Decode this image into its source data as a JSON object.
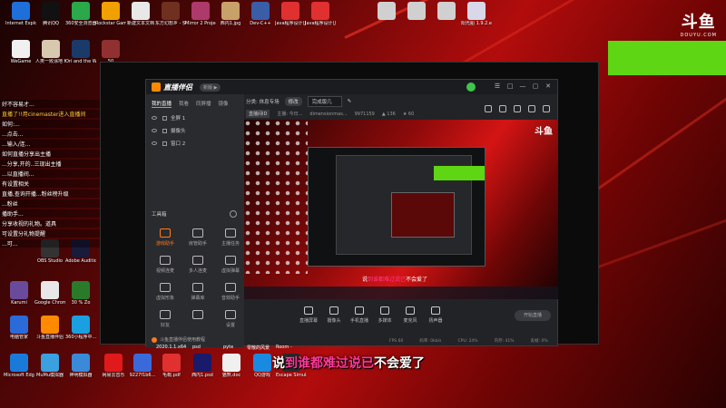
{
  "desktop": {
    "top_row": [
      {
        "label": "Internet Explorer",
        "color": "#1e6fd9"
      },
      {
        "label": "腾讯QQ",
        "color": "#111111"
      },
      {
        "label": "360安全浏览器",
        "color": "#2aa84a"
      },
      {
        "label": "Rockstar Games...",
        "color": "#f0a000"
      },
      {
        "label": "新建文本文档",
        "color": "#e8e8e8"
      },
      {
        "label": "东方幻想乡 - 快捷方式",
        "color": "#703020"
      },
      {
        "label": "Mirror 2 Project X",
        "color": "#ad3a6a"
      },
      {
        "label": "西内1.jpg",
        "color": "#c8a06a"
      },
      {
        "label": "Dev-C++",
        "color": "#3a5da8"
      },
      {
        "label": "Java程序设计(JDK8)...",
        "color": "#e03030"
      },
      {
        "label": "Java程序设计(JDK8)...",
        "color": "#e03030"
      },
      {
        "label": "",
        "color": "#d0d0d0"
      },
      {
        "label": "",
        "color": "#d0d0d0"
      },
      {
        "label": "",
        "color": "#d0d0d0"
      },
      {
        "label": "阳光船 1.9.2.exe...",
        "color": "#d8d8e8"
      }
    ],
    "row2": [
      {
        "label": "WeGame",
        "color": "#f0f0f0"
      },
      {
        "label": "人类一败涂地 Human Fa...",
        "color": "#d8c8b0"
      },
      {
        "label": "Ori and the Will of th...",
        "color": "#1a3a6a"
      },
      {
        "label": "50",
        "color": "#903030"
      }
    ],
    "left_col": [
      {
        "label": "Karumi",
        "color": "#6a4a9a"
      },
      {
        "label": "Google Chrome",
        "color": "#e8e8e8"
      },
      {
        "label": "30 % Zo",
        "color": "#2a7a2a"
      },
      {
        "label": "电脑管家",
        "color": "#2a6ad9"
      },
      {
        "label": "斗鱼直播伴侣",
        "color": "#ff8a00"
      },
      {
        "label": "360小程序中...",
        "color": "#1aa0e0"
      },
      {
        "label": "OBS Studio",
        "color": "#333333"
      },
      {
        "label": "Adobe Audition",
        "color": "#1a1a3a"
      },
      {
        "label": "Microsoft Edge",
        "color": "#1a7ad9"
      },
      {
        "label": "MuMu模拟器",
        "color": "#3aa0e0"
      },
      {
        "label": "神明模拟器",
        "color": "#3a8ad9"
      }
    ],
    "bottom_row": [
      {
        "label": "网易云音乐",
        "color": "#e01a1a"
      },
      {
        "label": "9227f1b6...",
        "color": "#3a6ad9"
      },
      {
        "label": "毛概.pdf",
        "color": "#e03030"
      },
      {
        "label": "西内1.psd",
        "color": "#1a1a6a"
      },
      {
        "label": "猫煞.doc",
        "color": "#f0f0f0"
      },
      {
        "label": "QQ游戏",
        "color": "#1a8ae0"
      },
      {
        "label": "Escape Simulator",
        "color": "#2a2a2a"
      }
    ],
    "bottom_file_labels": [
      "2020.1.1.x64",
      "psd",
      "pyte",
      "零散的风景",
      "Room -"
    ],
    "side_texts": [
      {
        "text": "好不容易才...",
        "highlight": false
      },
      {
        "text": "直播了!!用cinemaster进入直播间",
        "highlight": true
      },
      {
        "text": "如何:...",
        "highlight": false
      },
      {
        "text": "...点击...",
        "highlight": false
      },
      {
        "text": "...输入/连...",
        "highlight": false
      },
      {
        "text": "如何直播分享出主播",
        "highlight": false
      },
      {
        "text": "...分享,开的..三现出主播",
        "highlight": false
      },
      {
        "text": "...以直播间...",
        "highlight": false
      },
      {
        "text": "有设置相关",
        "highlight": false
      },
      {
        "text": "直播,查询开播...粉丝榜升级",
        "highlight": false
      },
      {
        "text": "...粉丝",
        "highlight": false
      },
      {
        "text": "播助手...",
        "highlight": false
      },
      {
        "text": "分享收视的礼物。道具",
        "highlight": false
      },
      {
        "text": "可设置分礼物提醒",
        "highlight": false
      },
      {
        "text": "...可...",
        "highlight": false
      }
    ],
    "logo_big": "斗鱼",
    "logo_small": "DOUYU.COM"
  },
  "app": {
    "name": "直播伴侣",
    "version_pill": "新版 ▶",
    "window_controls": [
      "☰",
      "□",
      "—",
      "▢",
      "✕"
    ],
    "left_tabs": [
      "我的直播",
      "我看",
      "同屏播",
      "镜像"
    ],
    "scene_items": [
      "全屏 1",
      "摄像头",
      "窗口 2"
    ],
    "tools_title": "工具箱",
    "tools": [
      {
        "label": "游戏助手",
        "accent": true
      },
      {
        "label": "房管助手",
        "accent": false
      },
      {
        "label": "主播任务",
        "accent": false
      },
      {
        "label": "视频连麦",
        "accent": false
      },
      {
        "label": "多人连麦",
        "accent": false
      },
      {
        "label": "虚拟弹幕",
        "accent": false
      },
      {
        "label": "虚拟形象",
        "accent": false
      },
      {
        "label": "弹幕库",
        "accent": false
      },
      {
        "label": "音效助手",
        "accent": false
      },
      {
        "label": "好友",
        "accent": false
      },
      {
        "label": "",
        "accent": false
      },
      {
        "label": "设置",
        "accent": false
      }
    ],
    "footer_note": "斗鱼直播伴侣使用教程",
    "info_bar": {
      "category_label": "分类: 休息专场",
      "edit_pill": "修改",
      "title_field": "完成版几",
      "edit_icon": "✎"
    },
    "stats": {
      "tag": "直播间ID",
      "items": [
        "主播: 今日...",
        "dimensionmas...",
        "9971159",
        "▲ 136",
        "★ 60"
      ]
    },
    "preview": {
      "logo": "斗鱼",
      "subtitle_pre": "说",
      "subtitle_hl": "到谁都难过说已",
      "subtitle_post": "不会爱了"
    },
    "bottom_buttons": [
      "直播屏幕",
      "摄像头",
      "手机直播",
      "多媒体",
      "麦克风",
      "扬声器"
    ],
    "live_button": "开始直播",
    "status_items": [
      "FPS 60",
      "码率: 0kb/s",
      "CPU: 24%",
      "内存: 41%",
      "丢帧: 0%"
    ]
  },
  "subtitle": {
    "pre": "说",
    "hl": "到谁都难过说已",
    "post": "不会爱了"
  },
  "colors": {
    "accent_orange": "#ff8a00",
    "douyu_green": "#5fd613",
    "subtitle_pink": "#ff3a9a"
  }
}
